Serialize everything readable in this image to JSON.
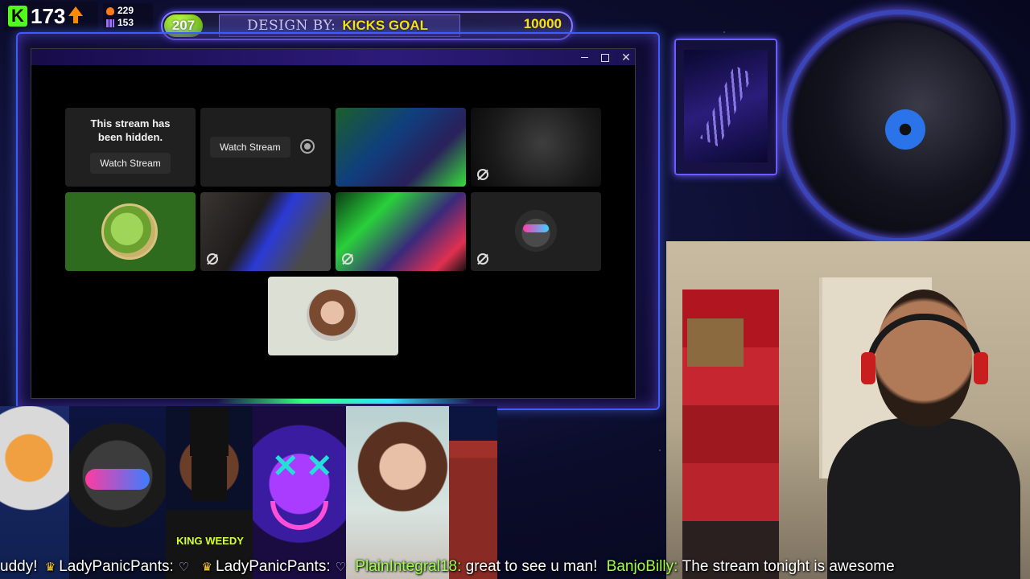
{
  "stats": {
    "kick_followers": "173",
    "stat_a": "229",
    "stat_b": "153"
  },
  "goal": {
    "current": "207",
    "design_by": "DESIGN BY:",
    "title": "KICKS GOAL",
    "target": "10000",
    "progress_fraction": 0.0207
  },
  "window": {
    "controls": {
      "minimize": "–",
      "maximize": "",
      "close": "✕"
    }
  },
  "streams": {
    "hidden_message": "This stream has been hidden.",
    "watch_stream_label": "Watch Stream",
    "watch_stream_label_2": "Watch Stream"
  },
  "overlay": {
    "weedy_tag": "KING WEEDY"
  },
  "chat": [
    {
      "user": "uddy!",
      "text": ""
    },
    {
      "user": "LadyPanicPants:",
      "text": ""
    },
    {
      "user": "LadyPanicPants:",
      "text": ""
    },
    {
      "user": "PlainIntegral18:",
      "text": "great to see u man!"
    },
    {
      "user": "BanjoBilly:",
      "text": "The stream tonight is awesome"
    }
  ],
  "colors": {
    "kick_green": "#53fc18",
    "goal_yellow": "#ffe800",
    "frame_blue": "#3e5bff",
    "chat_nick": "#9dff4a"
  },
  "icons": {
    "kick_logo": "kick-logo-icon",
    "up_arrow": "arrow-up-icon",
    "muted": "muted-icon",
    "focus": "focus-icon"
  }
}
